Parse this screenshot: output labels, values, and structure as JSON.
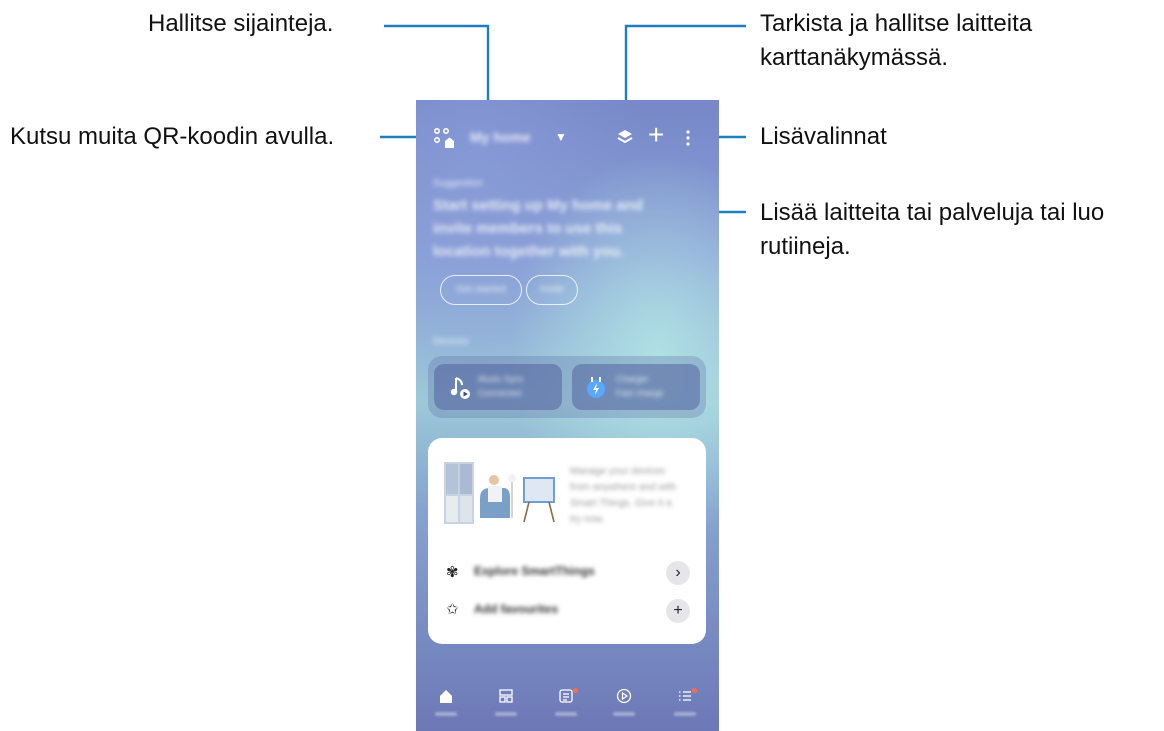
{
  "callouts": {
    "manage_locations": "Hallitse sijainteja.",
    "invite_qr": "Kutsu muita QR-koodin avulla.",
    "map_view_line1": "Tarkista ja hallitse laitteita",
    "map_view_line2": "karttanäkymässä.",
    "more_options": "Lisävalinnat",
    "add_devices_line1": "Lisää laitteita tai palveluja tai luo",
    "add_devices_line2": "rutiineja."
  },
  "app": {
    "location_label": "My home",
    "suggestion": {
      "title": "Suggestion",
      "text_line1": "Start setting up My home and",
      "text_line2": "invite members to use this",
      "text_line3": "location together with you.",
      "primary_chip": "Get started",
      "secondary_chip": "Invite"
    },
    "devices_header": "Devices",
    "devices": [
      {
        "name": "Music Sync",
        "status": "Connected",
        "icon": "music-note-icon"
      },
      {
        "name": "Charger",
        "status": "Fast charge",
        "icon": "power-plug-icon"
      }
    ],
    "promo": {
      "line1": "Manage your devices",
      "line2": "from anywhere and with",
      "line3": "Smart Things. Give it a",
      "line4": "try now."
    },
    "explore_label": "Explore SmartThings",
    "favorites_label": "Add favourites",
    "nav": [
      "Home",
      "Devices",
      "Life",
      "Routines",
      "Menu"
    ]
  },
  "colors": {
    "callout_line": "#1b7fc1",
    "notification_dot": "#ff6a4d"
  }
}
